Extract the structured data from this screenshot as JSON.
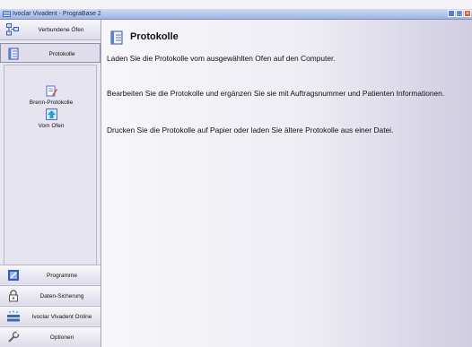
{
  "window": {
    "title": "Ivoclar Vivadent - PrograBase 2",
    "controls": {
      "minimize": "_",
      "maximize": "□",
      "close": "×"
    }
  },
  "sidebar": {
    "top_items": [
      {
        "label": "Verbundene Öfen",
        "icon": "network-icon"
      },
      {
        "label": "Protokolle",
        "icon": "document-icon",
        "active": true
      }
    ],
    "sub_items": [
      {
        "label": "Brenn-Protokolle",
        "icon": "edit-document-icon"
      },
      {
        "label": "Vom Ofen",
        "icon": "download-icon"
      }
    ],
    "bottom_items": [
      {
        "label": "Programme",
        "icon": "programs-icon"
      },
      {
        "label": "Daten-Sicherung",
        "icon": "lock-icon"
      },
      {
        "label": "Ivoclar Vivadent Online",
        "icon": "ivoclar-logo-icon"
      },
      {
        "label": "Optionen",
        "icon": "tools-icon"
      }
    ]
  },
  "main": {
    "title": "Protokolle",
    "paragraphs": [
      "Laden Sie die Protokolle vom ausgewählten Ofen auf den Computer.",
      "Bearbeiten Sie die Protokolle und ergänzen Sie sie mit Auftragsnummer und Patienten Informationen.",
      "Drucken Sie die Protokolle auf Papier oder laden Sie ältere Protokolle aus einer Datei."
    ]
  }
}
